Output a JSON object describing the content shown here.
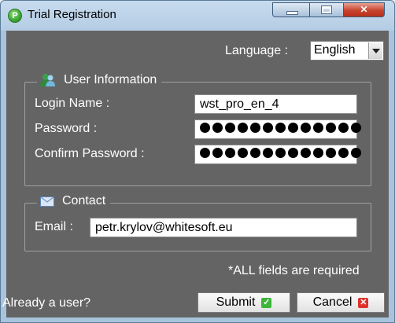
{
  "window": {
    "title": "Trial Registration",
    "app_icon_letter": "P"
  },
  "language": {
    "label": "Language :",
    "selected": "English"
  },
  "user_info": {
    "legend": "User Information",
    "login_name_label": "Login Name :",
    "login_name_value": "wst_pro_en_4",
    "password_label": "Password :",
    "confirm_password_label": "Confirm Password :",
    "password_mask_count": 13
  },
  "contact": {
    "legend": "Contact",
    "email_label": "Email :",
    "email_value": "petr.krylov@whitesoft.eu"
  },
  "footer": {
    "required_note": "*ALL fields are required",
    "already_user": "Already a user?",
    "submit_label": "Submit",
    "cancel_label": "Cancel"
  },
  "icons": {
    "app": "p-logo-icon",
    "user": "users-icon",
    "contact": "envelope-icon",
    "submit": "checkmark-icon",
    "cancel": "close-x-icon"
  },
  "colors": {
    "panel": "#646464",
    "submit_badge": "#3cb53a",
    "cancel_badge": "#e0322b"
  }
}
